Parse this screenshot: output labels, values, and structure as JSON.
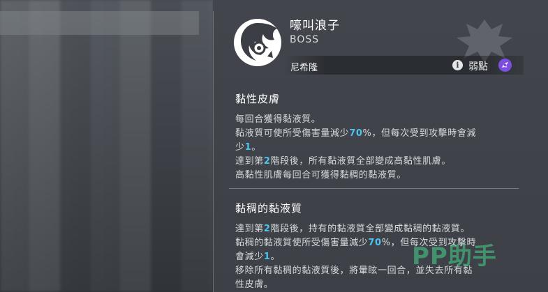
{
  "boss": {
    "name": "嚎叫浪子",
    "rank": "BOSS",
    "area": "尼希隆",
    "weakness_label": "弱點",
    "info_icon": "i"
  },
  "skills": [
    {
      "title": "黏性皮膚",
      "lines": [
        [
          "每回合獲得黏液質。"
        ],
        [
          "黏液質可使所受傷害量減少",
          {
            "hl": "70"
          },
          "%，但每次受到攻擊時會減"
        ],
        [
          "少",
          {
            "hl": "1"
          },
          "。"
        ],
        [
          "達到第",
          {
            "hl": "2"
          },
          "階段後，所有黏液質全部變成高黏性肌膚。"
        ],
        [
          "高黏性肌膚每回合可獲得黏稠的黏液質。"
        ]
      ]
    },
    {
      "title": "黏稠的黏液質",
      "lines": [
        [
          "達到第",
          {
            "hl": "2"
          },
          "階段後，持有的黏液質全部變成黏稠的黏液質。"
        ],
        [
          "黏稠的黏液質使所受傷害量減少",
          {
            "hl": "70"
          },
          "%，但每次受到攻擊時"
        ],
        [
          "會減少",
          {
            "hl": "1"
          },
          "。"
        ],
        [
          "移除所有黏稠的黏液質後，將暈眩一回合，並失去所有黏"
        ],
        [
          "性皮膚。"
        ]
      ]
    }
  ],
  "watermark": "PP助手",
  "colors": {
    "highlight": "#4cc3f0",
    "weakness": "#7b4ee0",
    "panel": "#42464c"
  }
}
